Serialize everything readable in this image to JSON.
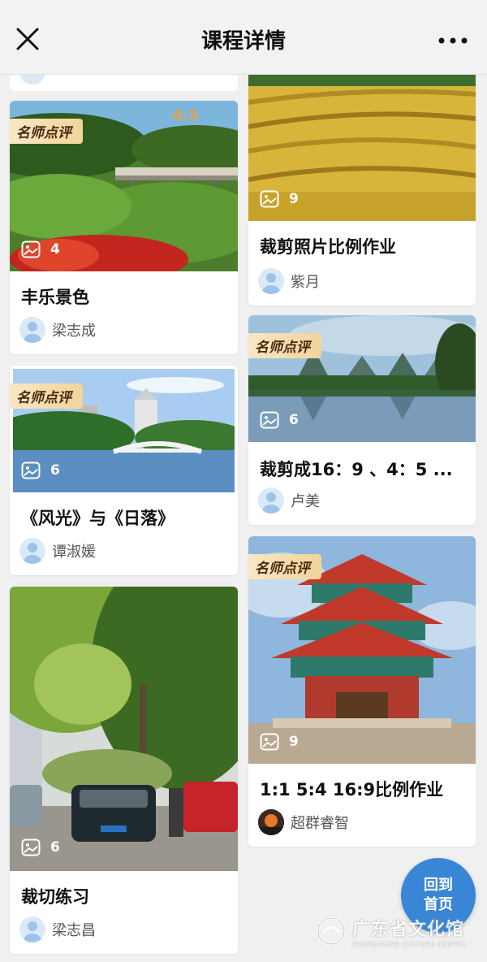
{
  "header": {
    "title": "课程详情",
    "close_icon": "close-icon",
    "more_icon": "more-icon"
  },
  "cards": [
    {
      "title": "丰乐景色",
      "author": "梁志成",
      "count": "4",
      "badge": "名师点评",
      "overlay_text": "4:3"
    },
    {
      "title": "《风光》与《日落》",
      "author": "谭淑媛",
      "count": "6",
      "badge": "名师点评"
    },
    {
      "title": "裁切练习",
      "author": "梁志昌",
      "count": "6"
    },
    {
      "title": "裁剪照片比例作业",
      "author": "紫月",
      "count": "9"
    },
    {
      "title": "裁剪成16：9 、4：5 ...",
      "author": "卢美",
      "count": "6",
      "badge": "名师点评"
    },
    {
      "title": "1:1 5:4 16:9比例作业",
      "author": "超群睿智",
      "count": "9",
      "badge": "名师点评"
    }
  ],
  "home_button": {
    "line1": "回到",
    "line2": "首页"
  },
  "watermark": {
    "cn": "广东省文化馆",
    "en": "GUANGDONG CULTURE CENTRE"
  },
  "colors": {
    "accent": "#3a86d6",
    "badge_bg": "#f2d49a",
    "page_bg": "#f0f0f0"
  }
}
